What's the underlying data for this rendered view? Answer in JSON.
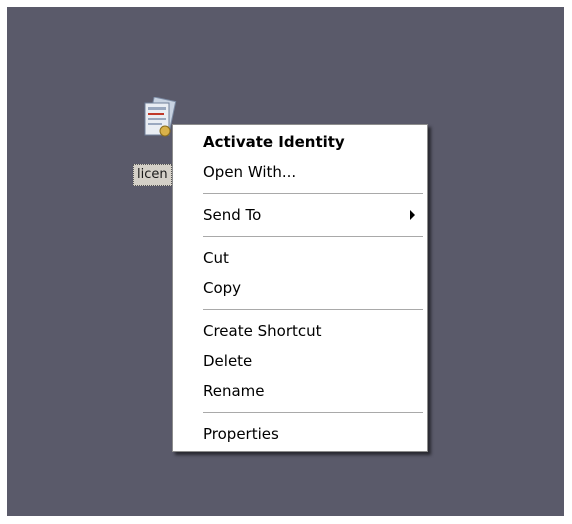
{
  "desktop": {
    "file_label": "licen",
    "file_icon": "certificate-document-icon"
  },
  "context_menu": {
    "items": [
      {
        "label": "Activate Identity",
        "bold": true
      },
      {
        "label": "Open With..."
      },
      {
        "label": "Send To",
        "submenu": true
      },
      {
        "label": "Cut"
      },
      {
        "label": "Copy"
      },
      {
        "label": "Create Shortcut"
      },
      {
        "label": "Delete"
      },
      {
        "label": "Rename"
      },
      {
        "label": "Properties"
      }
    ]
  }
}
